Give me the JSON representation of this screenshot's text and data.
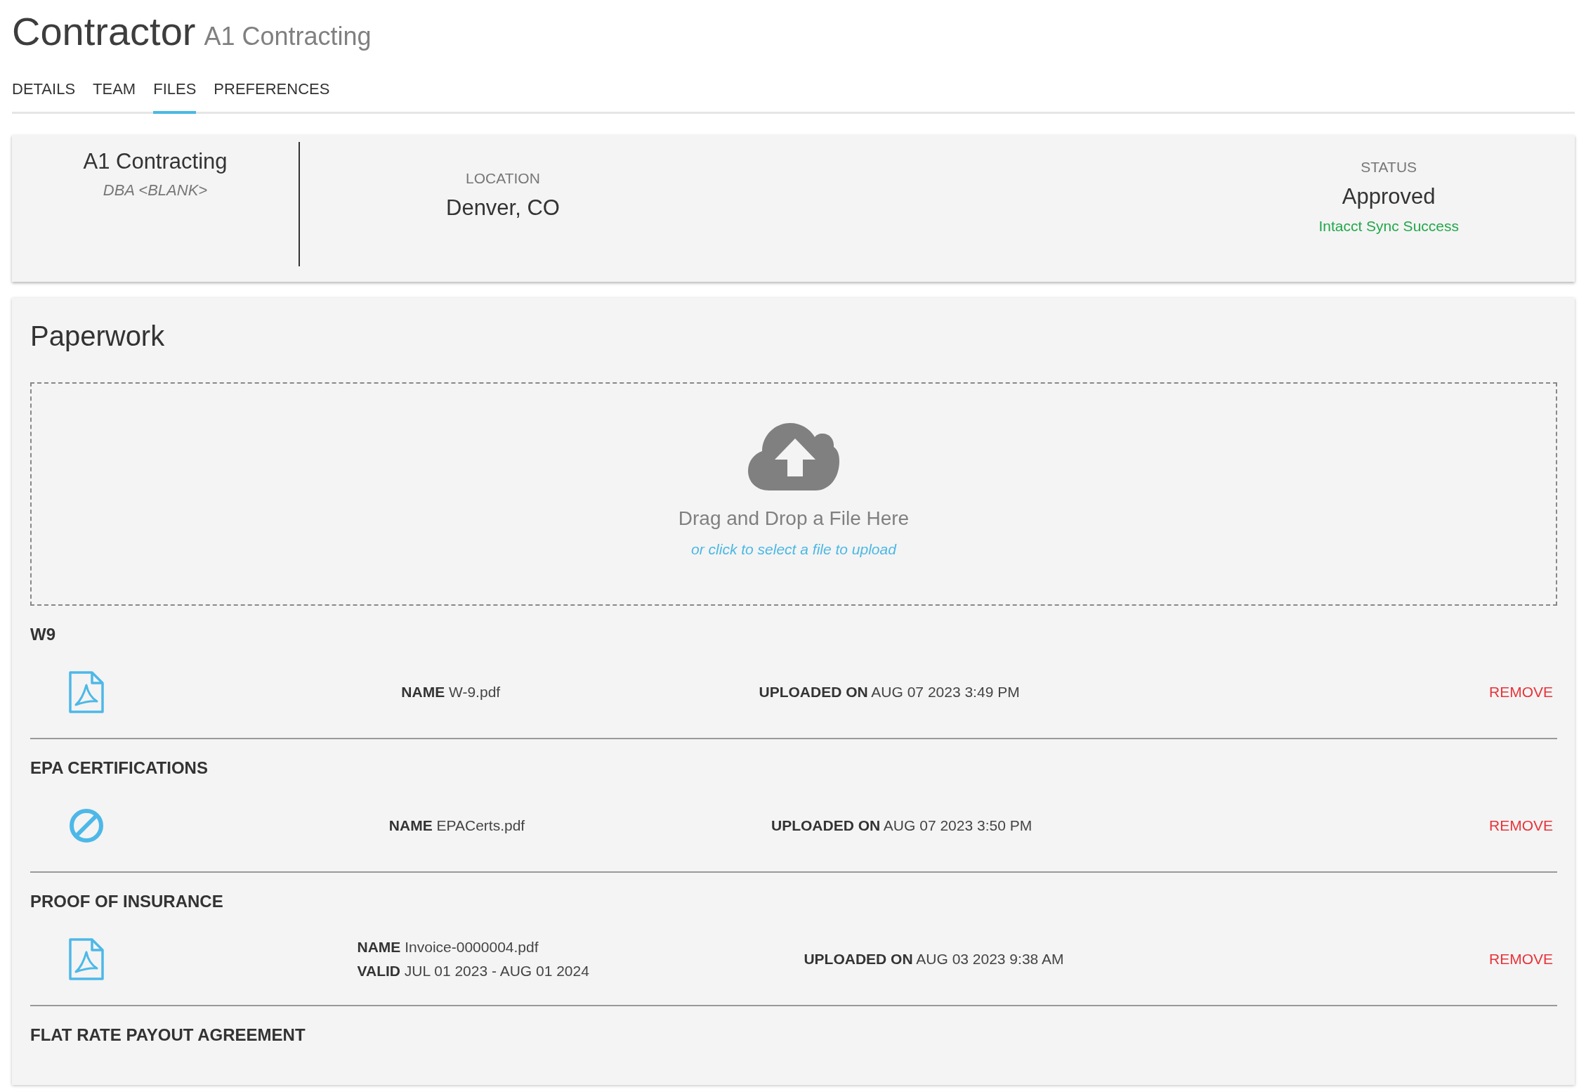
{
  "header": {
    "title": "Contractor",
    "subtitle": "A1 Contracting"
  },
  "tabs": [
    {
      "label": "DETAILS",
      "selected": false
    },
    {
      "label": "TEAM",
      "selected": false
    },
    {
      "label": "FILES",
      "selected": true
    },
    {
      "label": "PREFERENCES",
      "selected": false
    }
  ],
  "summary": {
    "name": "A1 Contracting",
    "dba": "DBA <BLANK>",
    "location_label": "LOCATION",
    "location": "Denver, CO",
    "status_label": "STATUS",
    "status": "Approved",
    "sync_status": "Intacct Sync Success"
  },
  "paperwork": {
    "title": "Paperwork",
    "dropzone": {
      "title": "Drag and Drop a File Here",
      "link": "or click to select a file to upload"
    },
    "sections": [
      {
        "title": "W9",
        "file": {
          "kind": "pdf",
          "name_label": "NAME",
          "name": "W-9.pdf",
          "uploaded_label": "UPLOADED ON",
          "uploaded": "AUG 07 2023 3:49 PM",
          "action": "REMOVE"
        }
      },
      {
        "title": "EPA CERTIFICATIONS",
        "file": {
          "kind": "blocked",
          "name_label": "NAME",
          "name": "EPACerts.pdf",
          "uploaded_label": "UPLOADED ON",
          "uploaded": "AUG 07 2023 3:50 PM",
          "action": "REMOVE"
        }
      },
      {
        "title": "PROOF OF INSURANCE",
        "file": {
          "kind": "pdf",
          "name_label": "NAME",
          "name": "Invoice-0000004.pdf",
          "valid_label": "VALID",
          "valid": "JUL 01 2023 - AUG 01 2024",
          "uploaded_label": "UPLOADED ON",
          "uploaded": "AUG 03 2023 9:38 AM",
          "action": "REMOVE"
        }
      },
      {
        "title": "FLAT RATE PAYOUT AGREEMENT"
      }
    ]
  }
}
